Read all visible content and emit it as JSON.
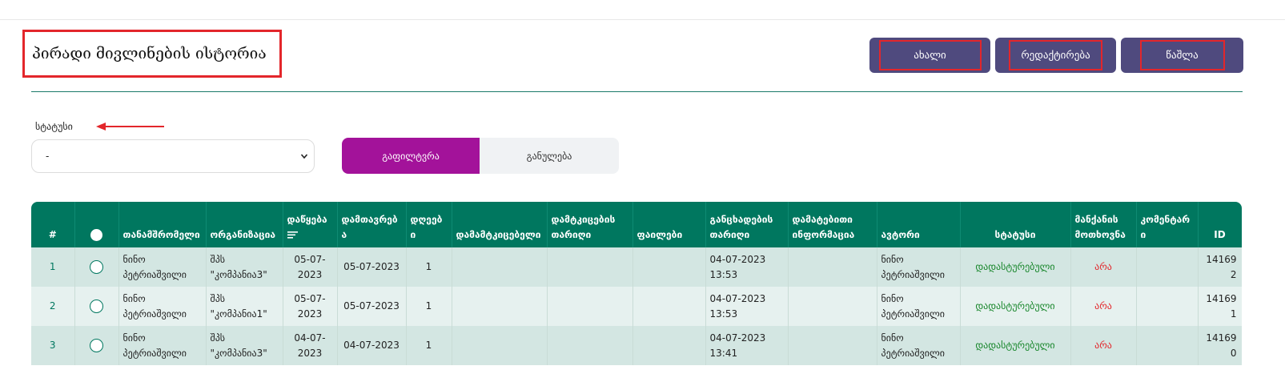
{
  "header": {
    "title": "პირადი მივლინების ისტორია",
    "buttons": {
      "new": "ახალი",
      "edit": "რედაქტირება",
      "delete": "წაშლა"
    }
  },
  "filters": {
    "status_label": "სტატუსი",
    "status_value": "-",
    "filter_button": "გაფილტვრა",
    "clear_button": "განულება"
  },
  "table": {
    "columns": {
      "num": "#",
      "employee": "თანამშრომელი",
      "organization": "ორგანიზაცია",
      "start": "დაწყება",
      "end": "დამთავრება",
      "days": "დღეები",
      "approver": "დამამტკიცებელი",
      "approval_date": "დამტკიცების თარიღი",
      "files": "ფაილები",
      "application_date": "განცხადების თარიღი",
      "additional_info": "დამატებითი ინფორმაცია",
      "author": "ავტორი",
      "status": "სტატუსი",
      "car_request": "მანქანის მოთხოვნა",
      "comment": "კომენტარი",
      "id": "ID"
    },
    "rows": [
      {
        "num": "1",
        "employee": "ნინო პეტრიაშვილი",
        "organization": "შპს \"კომპანია3\"",
        "start": "05-07-2023",
        "end": "05-07-2023",
        "days": "1",
        "approver": "",
        "approval_date": "",
        "files": "",
        "application_date": "04-07-2023 13:53",
        "additional_info": "",
        "author": "ნინო პეტრიაშვილი",
        "status": "დადასტურებული",
        "car_request": "არა",
        "comment": "",
        "id": "141692"
      },
      {
        "num": "2",
        "employee": "ნინო პეტრიაშვილი",
        "organization": "შპს \"კომპანია1\"",
        "start": "05-07-2023",
        "end": "05-07-2023",
        "days": "1",
        "approver": "",
        "approval_date": "",
        "files": "",
        "application_date": "04-07-2023 13:53",
        "additional_info": "",
        "author": "ნინო პეტრიაშვილი",
        "status": "დადასტურებული",
        "car_request": "არა",
        "comment": "",
        "id": "141691"
      },
      {
        "num": "3",
        "employee": "ნინო პეტრიაშვილი",
        "organization": "შპს \"კომპანია3\"",
        "start": "04-07-2023",
        "end": "04-07-2023",
        "days": "1",
        "approver": "",
        "approval_date": "",
        "files": "",
        "application_date": "04-07-2023 13:41",
        "additional_info": "",
        "author": "ნინო პეტრიაშვილი",
        "status": "დადასტურებული",
        "car_request": "არა",
        "comment": "",
        "id": "141690"
      }
    ]
  },
  "colors": {
    "header_green": "#00775f",
    "button_purple": "#4f4a7e",
    "filter_magenta": "#a3129a",
    "highlight_red": "#e3262b"
  },
  "icons": {
    "sort": "sort-descending-icon",
    "select_all": "circle-dot-icon",
    "dropdown": "chevron-down-icon",
    "arrow": "arrow-left-icon"
  }
}
